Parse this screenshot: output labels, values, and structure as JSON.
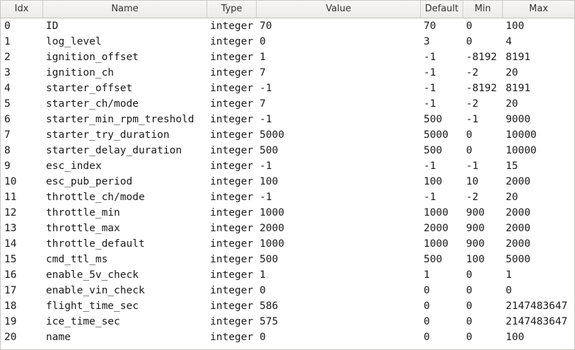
{
  "columns": {
    "idx": "Idx",
    "name": "Name",
    "type": "Type",
    "value": "Value",
    "default": "Default",
    "min": "Min",
    "max": "Max"
  },
  "rows": [
    {
      "idx": "0",
      "name": "ID",
      "type": "integer",
      "value": "70",
      "default": "70",
      "min": "0",
      "max": "100"
    },
    {
      "idx": "1",
      "name": "log_level",
      "type": "integer",
      "value": "0",
      "default": "3",
      "min": "0",
      "max": "4"
    },
    {
      "idx": "2",
      "name": "ignition_offset",
      "type": "integer",
      "value": "1",
      "default": "-1",
      "min": "-8192",
      "max": "8191"
    },
    {
      "idx": "3",
      "name": "ignition_ch",
      "type": "integer",
      "value": "7",
      "default": "-1",
      "min": "-2",
      "max": "20"
    },
    {
      "idx": "4",
      "name": "starter_offset",
      "type": "integer",
      "value": "-1",
      "default": "-1",
      "min": "-8192",
      "max": "8191"
    },
    {
      "idx": "5",
      "name": "starter_ch/mode",
      "type": "integer",
      "value": "7",
      "default": "-1",
      "min": "-2",
      "max": "20"
    },
    {
      "idx": "6",
      "name": "starter_min_rpm_treshold",
      "type": "integer",
      "value": "-1",
      "default": "500",
      "min": "-1",
      "max": "9000"
    },
    {
      "idx": "7",
      "name": "starter_try_duration",
      "type": "integer",
      "value": "5000",
      "default": "5000",
      "min": "0",
      "max": "10000"
    },
    {
      "idx": "8",
      "name": "starter_delay_duration",
      "type": "integer",
      "value": "500",
      "default": "500",
      "min": "0",
      "max": "10000"
    },
    {
      "idx": "9",
      "name": "esc_index",
      "type": "integer",
      "value": "-1",
      "default": "-1",
      "min": "-1",
      "max": "15"
    },
    {
      "idx": "10",
      "name": "esc_pub_period",
      "type": "integer",
      "value": "100",
      "default": "100",
      "min": "10",
      "max": "2000"
    },
    {
      "idx": "11",
      "name": "throttle_ch/mode",
      "type": "integer",
      "value": "-1",
      "default": "-1",
      "min": "-2",
      "max": "20"
    },
    {
      "idx": "12",
      "name": "throttle_min",
      "type": "integer",
      "value": "1000",
      "default": "1000",
      "min": "900",
      "max": "2000"
    },
    {
      "idx": "13",
      "name": "throttle_max",
      "type": "integer",
      "value": "2000",
      "default": "2000",
      "min": "900",
      "max": "2000"
    },
    {
      "idx": "14",
      "name": "throttle_default",
      "type": "integer",
      "value": "1000",
      "default": "1000",
      "min": "900",
      "max": "2000"
    },
    {
      "idx": "15",
      "name": "cmd_ttl_ms",
      "type": "integer",
      "value": "500",
      "default": "500",
      "min": "100",
      "max": "5000"
    },
    {
      "idx": "16",
      "name": "enable_5v_check",
      "type": "integer",
      "value": "1",
      "default": "1",
      "min": "0",
      "max": "1"
    },
    {
      "idx": "17",
      "name": "enable_vin_check",
      "type": "integer",
      "value": "0",
      "default": "0",
      "min": "0",
      "max": "0"
    },
    {
      "idx": "18",
      "name": "flight_time_sec",
      "type": "integer",
      "value": "586",
      "default": "0",
      "min": "0",
      "max": "2147483647"
    },
    {
      "idx": "19",
      "name": "ice_time_sec",
      "type": "integer",
      "value": "575",
      "default": "0",
      "min": "0",
      "max": "2147483647"
    },
    {
      "idx": "20",
      "name": "name",
      "type": "integer",
      "value": "0",
      "default": "0",
      "min": "0",
      "max": "100"
    }
  ]
}
